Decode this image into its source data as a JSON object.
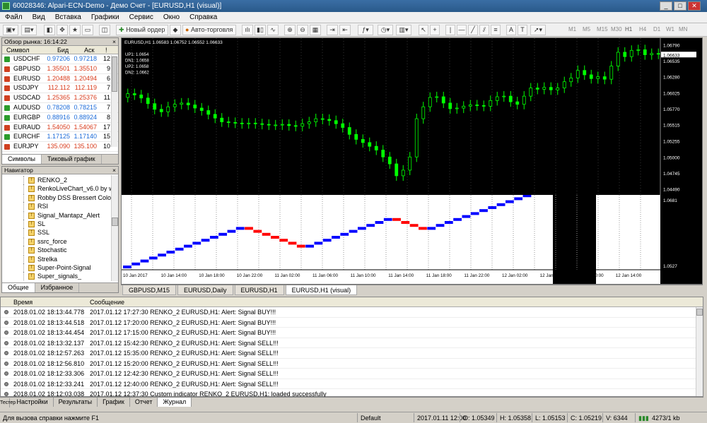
{
  "window": {
    "title": "60028346: Alpari-ECN-Demo - Демо Счет - [EURUSD,H1 (visual)]"
  },
  "menu": [
    "Файл",
    "Вид",
    "Вставка",
    "Графики",
    "Сервис",
    "Окно",
    "Справка"
  ],
  "toolbar": {
    "new_order": "Новый ордер",
    "autotrade": "Авто-торговля",
    "timeframes": [
      "M1",
      "M5",
      "M15",
      "M30",
      "H1",
      "H4",
      "D1",
      "W1",
      "MN"
    ]
  },
  "market_watch": {
    "title": "Обзор рынка: 16:14:22",
    "columns": {
      "symbol": "Символ",
      "bid": "Бид",
      "ask": "Аск",
      "spread": "!"
    },
    "rows": [
      {
        "symbol": "USDCHF",
        "bid": "0.97206",
        "ask": "0.97218",
        "spread": "12",
        "dir": "up"
      },
      {
        "symbol": "GBPUSD",
        "bid": "1.35501",
        "ask": "1.35510",
        "spread": "9",
        "dir": "down"
      },
      {
        "symbol": "EURUSD",
        "bid": "1.20488",
        "ask": "1.20494",
        "spread": "6",
        "dir": "down"
      },
      {
        "symbol": "USDJPY",
        "bid": "112.112",
        "ask": "112.119",
        "spread": "7",
        "dir": "down"
      },
      {
        "symbol": "USDCAD",
        "bid": "1.25365",
        "ask": "1.25376",
        "spread": "11",
        "dir": "down"
      },
      {
        "symbol": "AUDUSD",
        "bid": "0.78208",
        "ask": "0.78215",
        "spread": "7",
        "dir": "up"
      },
      {
        "symbol": "EURGBP",
        "bid": "0.88916",
        "ask": "0.88924",
        "spread": "8",
        "dir": "up"
      },
      {
        "symbol": "EURAUD",
        "bid": "1.54050",
        "ask": "1.54067",
        "spread": "17",
        "dir": "down"
      },
      {
        "symbol": "EURCHF",
        "bid": "1.17125",
        "ask": "1.17140",
        "spread": "15",
        "dir": "up"
      },
      {
        "symbol": "EURJPY",
        "bid": "135.090",
        "ask": "135.100",
        "spread": "10",
        "dir": "down"
      }
    ],
    "tabs": [
      "Символы",
      "Тиковый график"
    ]
  },
  "navigator": {
    "title": "Навигатор",
    "items": [
      "RENKO_2",
      "RenkoLiveChart_v6.0 by www",
      "Robby DSS Bressert Colored",
      "RSI",
      "Signal_Mantapz_Alert",
      "SL",
      "SSL",
      "ssrc_force",
      "Stochastic",
      "Strelka",
      "Super-Point-Signal",
      "Super_signals_"
    ],
    "tabs": [
      "Общие",
      "Избранное"
    ]
  },
  "chart": {
    "header": "EURUSD,H1  1.06583 1.06752 1.06552 1.06633",
    "levels": [
      "UP1: 1.0654",
      "DN1: 1.0658",
      "UP2: 1.0658",
      "DN2: 1.0662"
    ],
    "price_labels": [
      "1.06790",
      "1.06633",
      "1.06535",
      "1.06280",
      "1.06025",
      "1.05770",
      "1.05515",
      "1.05255",
      "1.05000",
      "1.04745",
      "1.04490"
    ],
    "sub_labels": [
      "1.0681",
      "1.0527"
    ],
    "time_labels": [
      "10 Jan 2017",
      "10 Jan 14:00",
      "10 Jan 18:00",
      "10 Jan 22:00",
      "11 Jan 02:00",
      "11 Jan 06:00",
      "11 Jan 10:00",
      "11 Jan 14:00",
      "11 Jan 18:00",
      "11 Jan 22:00",
      "12 Jan 02:00",
      "12 Jan 06:00",
      "12 Jan 10:00",
      "12 Jan 14:00"
    ],
    "tabs": [
      "GBPUSD,M15",
      "EURUSD,Daily",
      "EURUSD,H1",
      "EURUSD,H1 (visual)"
    ],
    "colors": {
      "bull": "#00ff00",
      "bear": "#00ff00",
      "renko_up": "#0000ff",
      "renko_down": "#ff0000"
    }
  },
  "journal": {
    "columns": {
      "time": "Время",
      "message": "Сообщение"
    },
    "rows": [
      {
        "time": "2018.01.02 18:13:44.778",
        "message": "2017.01.12 17:27:30  RENKO_2 EURUSD,H1: Alert: Signal BUY!!!"
      },
      {
        "time": "2018.01.02 18:13:44.518",
        "message": "2017.01.12 17:20:00  RENKO_2 EURUSD,H1: Alert: Signal BUY!!!"
      },
      {
        "time": "2018.01.02 18:13:44.454",
        "message": "2017.01.12 17:15:00  RENKO_2 EURUSD,H1: Alert: Signal BUY!!!"
      },
      {
        "time": "2018.01.02 18:13:32.137",
        "message": "2017.01.12 15:42:30  RENKO_2 EURUSD,H1: Alert: Signal SELL!!!"
      },
      {
        "time": "2018.01.02 18:12:57.263",
        "message": "2017.01.12 15:35:00  RENKO_2 EURUSD,H1: Alert: Signal SELL!!!"
      },
      {
        "time": "2018.01.02 18:12:56.810",
        "message": "2017.01.12 15:20:00  RENKO_2 EURUSD,H1: Alert: Signal SELL!!!"
      },
      {
        "time": "2018.01.02 18:12:33.306",
        "message": "2017.01.12 12:42:30  RENKO_2 EURUSD,H1: Alert: Signal SELL!!!"
      },
      {
        "time": "2018.01.02 18:12:33.241",
        "message": "2017.01.12 12:40:00  RENKO_2 EURUSD,H1: Alert: Signal SELL!!!"
      },
      {
        "time": "2018.01.02 18:12:03.038",
        "message": "2017.01.12 12:37:30  Custom indicator RENKO_2 EURUSD,H1: loaded successfully"
      }
    ],
    "tabs": [
      "Настройки",
      "Результаты",
      "График",
      "Отчет",
      "Журнал"
    ],
    "side_label": "Тестер"
  },
  "status": {
    "help": "Для вызова справки нажмите F1",
    "profile": "Default",
    "time": "2017.01.11 12:00",
    "open": "O: 1.05349",
    "high": "H: 1.05358",
    "low": "L: 1.05153",
    "close": "C: 1.05219",
    "volume": "V: 6344",
    "traffic": "4273/1 kb"
  }
}
